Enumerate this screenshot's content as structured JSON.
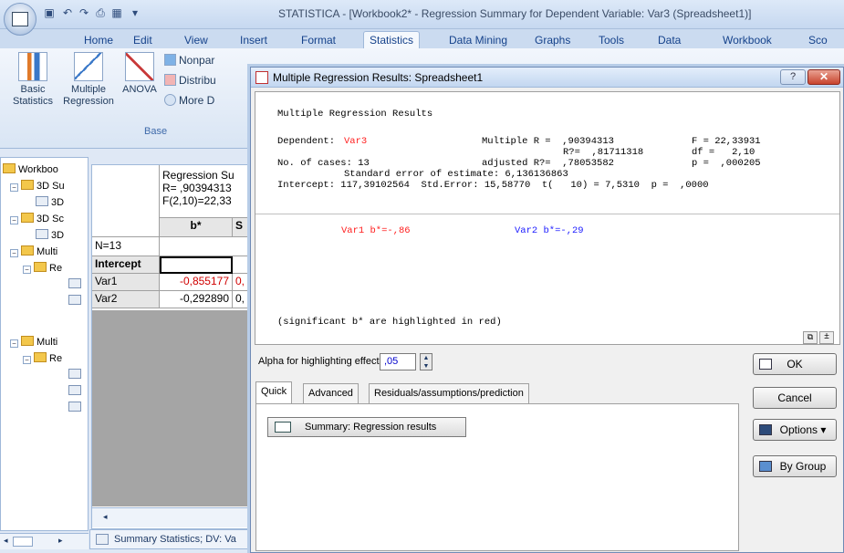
{
  "app": {
    "title": "STATISTICA - [Workbook2* - Regression Summary for Dependent Variable: Var3 (Spreadsheet1)]"
  },
  "ribbon": {
    "tabs": [
      "Home",
      "Edit",
      "View",
      "Insert",
      "Format",
      "Statistics",
      "Data Mining",
      "Graphs",
      "Tools",
      "Data",
      "Workbook",
      "Sco"
    ],
    "active_tab": "Statistics",
    "buttons": {
      "basic_statistics": "Basic\nStatistics",
      "multiple_regression": "Multiple\nRegression",
      "anova": "ANOVA"
    },
    "small_buttons": [
      "Nonpar",
      "Distribu",
      "More D"
    ],
    "group_label": "Base"
  },
  "tree": {
    "items": [
      {
        "label": "Workboo",
        "level": 0,
        "type": "folder"
      },
      {
        "label": "3D Su",
        "level": 1,
        "type": "folder"
      },
      {
        "label": "3D",
        "level": 2,
        "type": "sheet"
      },
      {
        "label": "3D Sc",
        "level": 1,
        "type": "folder"
      },
      {
        "label": "3D",
        "level": 2,
        "type": "sheet"
      },
      {
        "label": "Multi",
        "level": 1,
        "type": "folder"
      },
      {
        "label": "Re",
        "level": 2,
        "type": "folder"
      },
      {
        "label": "",
        "level": 3,
        "type": "sheet"
      },
      {
        "label": "",
        "level": 3,
        "type": "sheet"
      },
      {
        "label": "Multi",
        "level": 1,
        "type": "folder"
      },
      {
        "label": "Re",
        "level": 2,
        "type": "folder"
      },
      {
        "label": "",
        "level": 3,
        "type": "sheet"
      },
      {
        "label": "",
        "level": 3,
        "type": "sheet"
      },
      {
        "label": "",
        "level": 3,
        "type": "sheet"
      }
    ]
  },
  "spreadsheet": {
    "header_lines": [
      "Regression Su",
      "R= ,90394313",
      "F(2,10)=22,33"
    ],
    "n_label": "N=13",
    "col_b": "b*",
    "col_s": "S",
    "rows": [
      {
        "label": "Intercept",
        "b": ""
      },
      {
        "label": "Var1",
        "b": "-0,855177",
        "s": "0,"
      },
      {
        "label": "Var2",
        "b": "-0,292890",
        "s": "0,"
      }
    ],
    "bottom_tab": "Summary Statistics; DV: Va"
  },
  "dialog": {
    "title": "Multiple Regression Results: Spreadsheet1",
    "help_label": "?",
    "close_label": "✕",
    "results": {
      "heading": "Multiple Regression Results",
      "dependent_label": "Dependent:",
      "dependent_value": "Var3",
      "multiple_r": "Multiple R =  ,90394313",
      "f_stat": "F = 22,33931",
      "r2": "R?=  ,81711318",
      "df": "df =   2,10",
      "cases": "No. of cases: 13",
      "adj_r2": "adjusted R?=  ,78053582",
      "p": "p =  ,000205",
      "std_err": "Standard error of estimate: 6,136136863",
      "intercept": "Intercept: 117,39102564  Std.Error: 15,58770  t(   10) = 7,5310  p =  ,0000",
      "var1_beta": "Var1 b*=-,86",
      "var2_beta": "Var2 b*=-,29",
      "note": "(significant b* are highlighted in red)"
    },
    "alpha_label": "Alpha for highlighting effects:",
    "alpha_value": ",05",
    "tabs": [
      "Quick",
      "Advanced",
      "Residuals/assumptions/prediction"
    ],
    "active_tab": "Quick",
    "summary_button": "Summary:  Regression results",
    "ok_label": "OK",
    "cancel_label": "Cancel",
    "options_label": "Options ▾",
    "bygroup_label": "By Group"
  }
}
